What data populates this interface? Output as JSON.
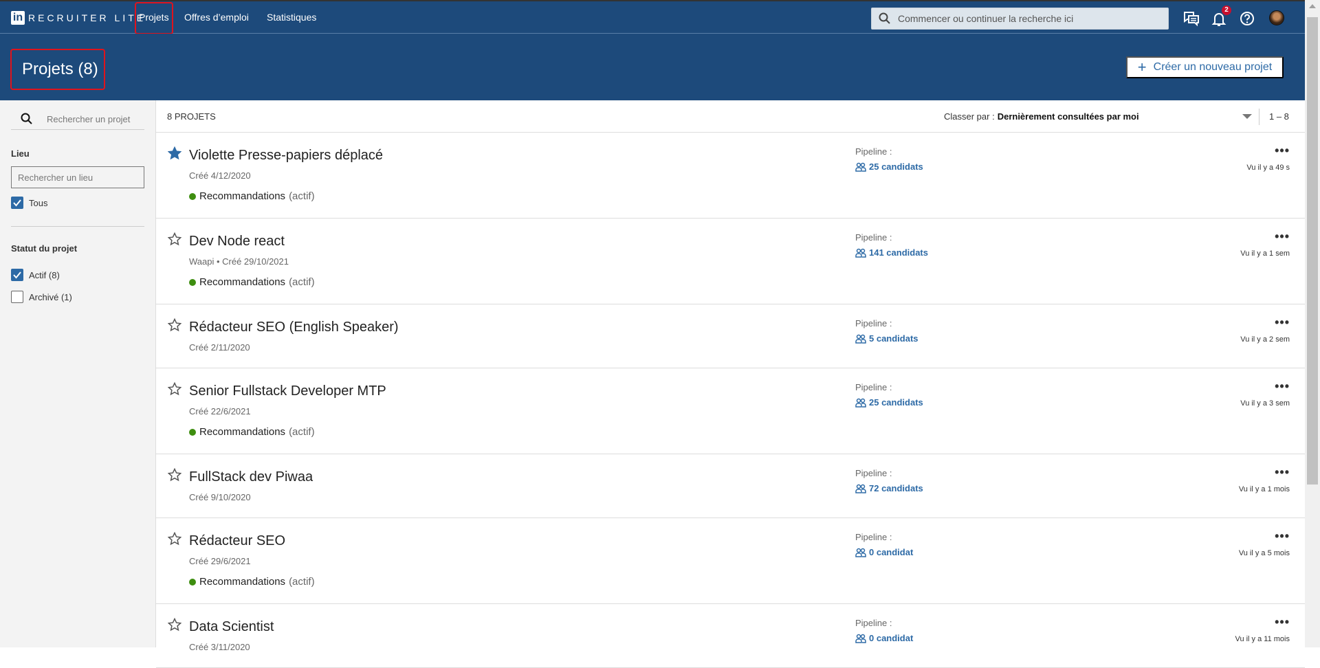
{
  "nav": {
    "brand": "RECRUITER LITE",
    "links": [
      "Projets",
      "Offres d’emploi",
      "Statistiques"
    ],
    "search_placeholder": "Commencer ou continuer la recherche ici",
    "notifications": "2"
  },
  "header": {
    "title": "Projets (8)",
    "new_project": "Créer un nouveau projet"
  },
  "sidebar": {
    "search_placeholder": "Rechercher un projet",
    "location_heading": "Lieu",
    "location_placeholder": "Rechercher un lieu",
    "location_all": "Tous",
    "status_heading": "Statut du projet",
    "active": "Actif (8)",
    "archived": "Archivé (1)"
  },
  "list": {
    "count": "8 PROJETS",
    "sort_label": "Classer par :",
    "sort_value": "Dernièrement consultées par moi",
    "range": "1 – 8",
    "pipeline_label": "Pipeline :",
    "rec_label": "Recommandations",
    "rec_status": "(actif)"
  },
  "projects": [
    {
      "title": "Violette Presse-papiers déplacé",
      "meta": "Créé 4/12/2020",
      "starred": true,
      "rec": true,
      "candidates": "25 candidats",
      "seen": "Vu il y a 49 s"
    },
    {
      "title": "Dev Node react",
      "meta": "Waapi • Créé 29/10/2021",
      "starred": false,
      "rec": true,
      "candidates": "141 candidats",
      "seen": "Vu il y a 1 sem"
    },
    {
      "title": "Rédacteur SEO (English Speaker)",
      "meta": "Créé 2/11/2020",
      "starred": false,
      "rec": false,
      "candidates": "5 candidats",
      "seen": "Vu il y a 2 sem"
    },
    {
      "title": "Senior Fullstack Developer MTP",
      "meta": "Créé 22/6/2021",
      "starred": false,
      "rec": true,
      "candidates": "25 candidats",
      "seen": "Vu il y a 3 sem"
    },
    {
      "title": "FullStack dev Piwaa",
      "meta": "Créé 9/10/2020",
      "starred": false,
      "rec": false,
      "candidates": "72 candidats",
      "seen": "Vu il y a 1 mois"
    },
    {
      "title": "Rédacteur SEO",
      "meta": "Créé 29/6/2021",
      "starred": false,
      "rec": true,
      "candidates": "0 candidat",
      "seen": "Vu il y a 5 mois"
    },
    {
      "title": "Data Scientist",
      "meta": "Créé 3/11/2020",
      "starred": false,
      "rec": false,
      "candidates": "0 candidat",
      "seen": "Vu il y a 11 mois"
    }
  ]
}
